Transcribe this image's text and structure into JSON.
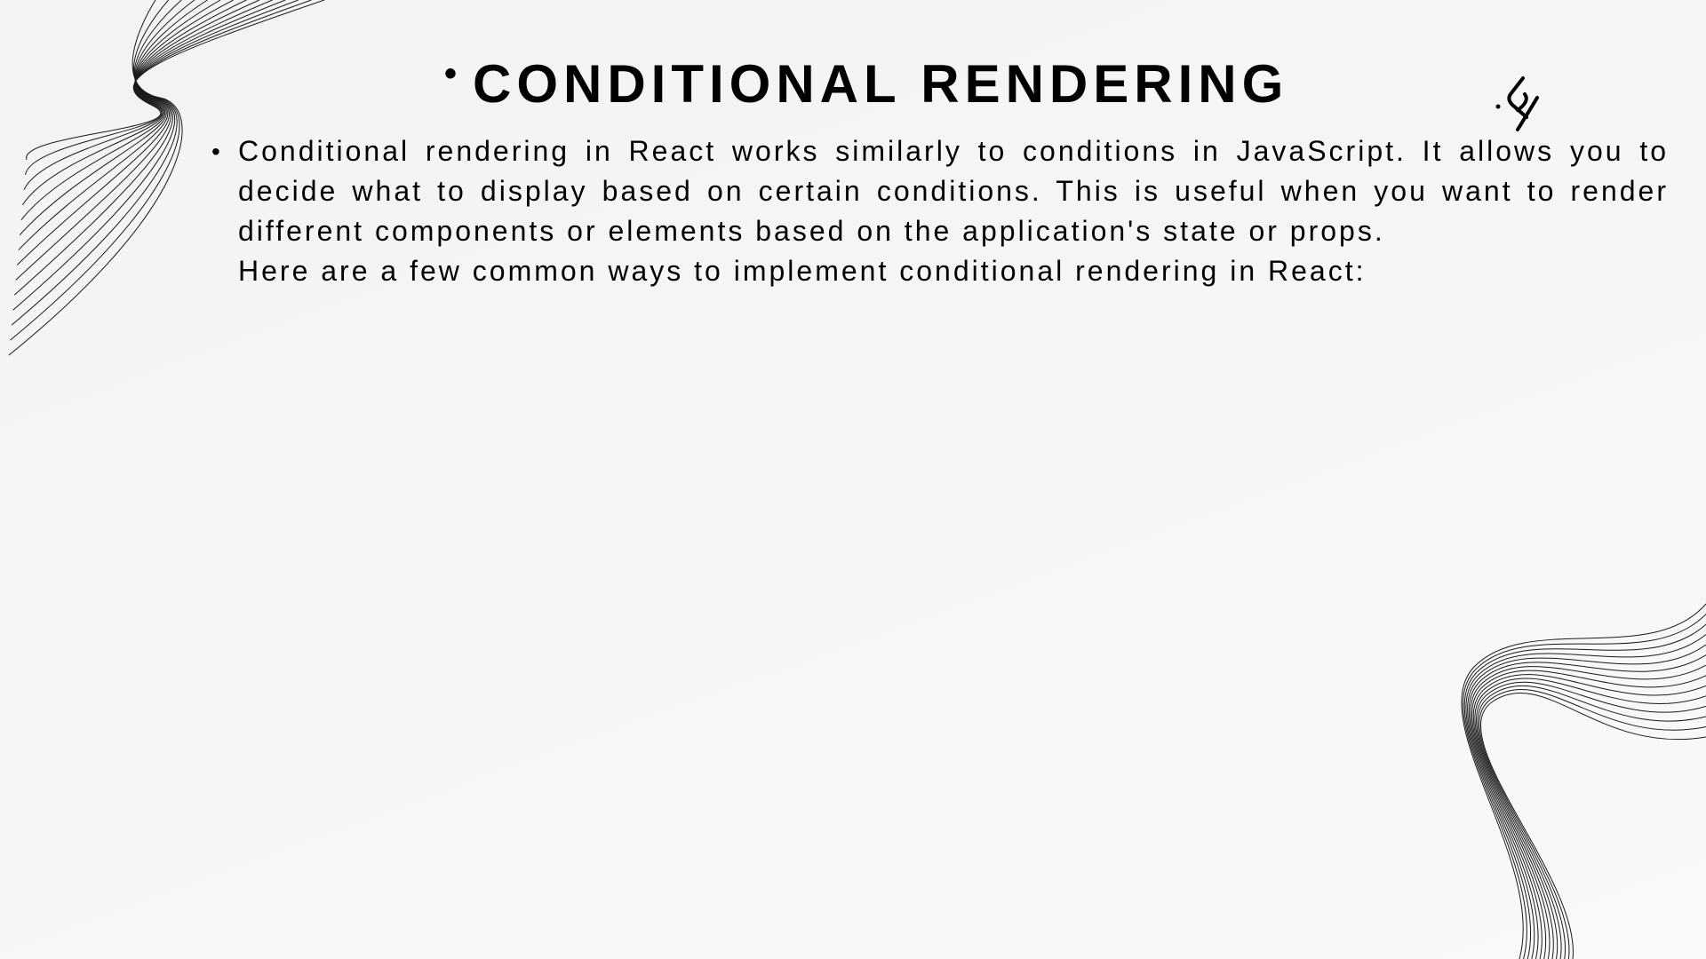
{
  "slide": {
    "title": "CONDITIONAL RENDERING",
    "title_bullet": "•",
    "body_bullet": "•",
    "paragraph": "Conditional rendering in React works similarly to conditions in JavaScript. It allows you to decide what to display based on certain conditions. This is useful when you want to render different components or elements based on the application's state or props.",
    "intro_line": "Here are a few common ways to implement conditional rendering in React:"
  },
  "decorations": {
    "top_left": "wave-lines",
    "bottom_right": "wave-lines",
    "logo": "logo-icon"
  },
  "colors": {
    "background": "#f4f5f6",
    "text": "#000000",
    "lines": "#1a1a1a"
  }
}
